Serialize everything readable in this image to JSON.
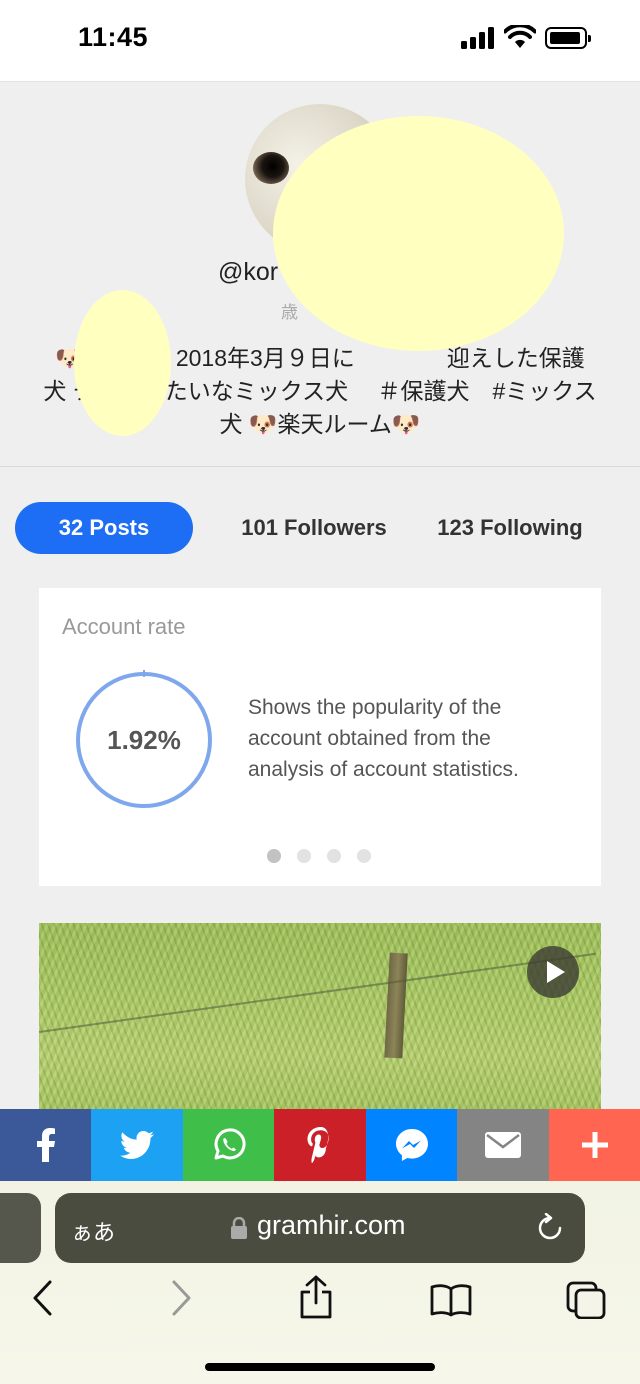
{
  "status_bar": {
    "time": "11:45"
  },
  "profile": {
    "username": "@kor",
    "sub_snippet": "歳",
    "bio_lines": [
      "🐶ニ　　　2018年3月９日に　　　　迎えした保護",
      "犬 チ　　　たいなミックス犬　 ＃保護犬　#ミックス",
      "犬 🐶楽天ルーム🐶"
    ]
  },
  "stats": {
    "posts": "32 Posts",
    "followers": "101 Followers",
    "following": "123 Following"
  },
  "account_rate": {
    "title": "Account rate",
    "value": "1.92%",
    "description": "Shows the popularity of the account obtained from the analysis of account statistics.",
    "slides_total": 4,
    "active_slide": 1
  },
  "share_bar": [
    {
      "name": "facebook",
      "color": "#3b5998"
    },
    {
      "name": "twitter",
      "color": "#1da1f2"
    },
    {
      "name": "whatsapp",
      "color": "#3fbf4a"
    },
    {
      "name": "pinterest",
      "color": "#cb2027"
    },
    {
      "name": "messenger",
      "color": "#0084ff"
    },
    {
      "name": "email",
      "color": "#848484"
    },
    {
      "name": "more",
      "color": "#ff6550"
    }
  ],
  "browser": {
    "text_size_label": "ぁあ",
    "url": "gramhir.com"
  },
  "colors": {
    "accent": "#1d6ef5",
    "ring": "#7fa8ec",
    "redaction": "#ffffc0"
  }
}
